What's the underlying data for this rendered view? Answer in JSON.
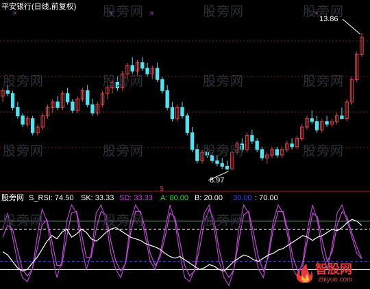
{
  "colors": {
    "background": "#000000",
    "up": "#e0424a",
    "down": "#4fe3f0",
    "white_line": "#ffffff",
    "sk_line": "#b147c9",
    "sd_line": "#c44ad6",
    "upper_band": "#43d94d",
    "lower_band": "#3a4ad8",
    "label_cyan": "#36e0e8",
    "label_green": "#2fd634",
    "label_blue": "#3a4ad8",
    "grid": "#7a1f1f"
  },
  "header": {
    "title": "平安银行(日线,前复权)"
  },
  "price_annotations": {
    "high": "13.86",
    "low": "8.97"
  },
  "watermark": "股旁网",
  "indicator": {
    "name": "股旁网",
    "s_rsi_label": "S_RSI: 74.50",
    "sk_label": "SK: 33.33",
    "sd_label": "SD: 33.33",
    "a_label": "A: 80.00",
    "b_label": "B: 20.00",
    "c_label": "30.00",
    "d_label": ": 70.00"
  },
  "logo": {
    "name": "智股网",
    "url": "zhiyue.com"
  },
  "chart_data": {
    "type": "candlestick",
    "price_panel": {
      "ylim": [
        8.5,
        14.5
      ],
      "high_value": 13.86,
      "low_value": 8.97,
      "candles": [
        [
          11.6,
          11.9,
          11.4,
          11.8
        ],
        [
          11.8,
          12.0,
          11.6,
          11.7
        ],
        [
          11.7,
          11.8,
          11.1,
          11.2
        ],
        [
          11.2,
          11.4,
          10.8,
          10.9
        ],
        [
          10.9,
          11.0,
          10.5,
          10.6
        ],
        [
          10.6,
          10.9,
          10.5,
          10.8
        ],
        [
          10.8,
          10.9,
          10.2,
          10.3
        ],
        [
          10.3,
          10.6,
          10.2,
          10.5
        ],
        [
          10.5,
          11.0,
          10.4,
          10.9
        ],
        [
          10.9,
          11.3,
          10.8,
          11.2
        ],
        [
          11.2,
          11.5,
          11.0,
          11.4
        ],
        [
          11.4,
          11.6,
          11.1,
          11.2
        ],
        [
          11.2,
          11.8,
          11.1,
          11.7
        ],
        [
          11.7,
          11.9,
          11.3,
          11.4
        ],
        [
          11.4,
          11.5,
          11.0,
          11.1
        ],
        [
          11.1,
          11.6,
          11.0,
          11.5
        ],
        [
          11.5,
          11.9,
          11.4,
          11.8
        ],
        [
          11.8,
          12.0,
          11.2,
          11.3
        ],
        [
          11.3,
          11.5,
          10.9,
          11.0
        ],
        [
          11.0,
          11.4,
          10.9,
          11.3
        ],
        [
          11.3,
          11.8,
          11.2,
          11.7
        ],
        [
          11.7,
          12.0,
          11.5,
          11.9
        ],
        [
          11.9,
          12.2,
          11.7,
          12.1
        ],
        [
          12.1,
          12.3,
          11.8,
          11.9
        ],
        [
          11.9,
          12.5,
          11.8,
          12.4
        ],
        [
          12.4,
          12.8,
          12.2,
          12.7
        ],
        [
          12.7,
          13.0,
          12.4,
          12.5
        ],
        [
          12.5,
          12.9,
          12.3,
          12.8
        ],
        [
          12.8,
          13.0,
          12.5,
          12.6
        ],
        [
          12.6,
          12.8,
          12.3,
          12.4
        ],
        [
          12.4,
          12.7,
          12.2,
          12.6
        ],
        [
          12.6,
          12.8,
          12.1,
          12.2
        ],
        [
          12.2,
          12.3,
          11.7,
          11.8
        ],
        [
          11.8,
          12.0,
          11.1,
          11.2
        ],
        [
          11.2,
          11.4,
          10.7,
          10.8
        ],
        [
          10.8,
          11.3,
          10.7,
          11.2
        ],
        [
          11.2,
          11.4,
          10.8,
          10.9
        ],
        [
          10.9,
          11.0,
          10.2,
          10.3
        ],
        [
          10.3,
          10.5,
          9.6,
          9.7
        ],
        [
          9.7,
          9.9,
          9.2,
          9.3
        ],
        [
          9.3,
          9.7,
          9.2,
          9.6
        ],
        [
          9.6,
          9.8,
          9.4,
          9.5
        ],
        [
          9.5,
          9.6,
          9.2,
          9.3
        ],
        [
          9.3,
          9.5,
          9.1,
          9.2
        ],
        [
          9.2,
          9.4,
          9.0,
          9.1
        ],
        [
          9.1,
          9.3,
          8.97,
          9.0
        ],
        [
          9.0,
          9.7,
          8.98,
          9.6
        ],
        [
          9.6,
          10.0,
          9.5,
          9.9
        ],
        [
          9.9,
          10.1,
          9.6,
          9.7
        ],
        [
          9.7,
          10.3,
          9.6,
          10.2
        ],
        [
          10.2,
          10.4,
          9.9,
          10.0
        ],
        [
          10.0,
          10.1,
          9.6,
          9.7
        ],
        [
          9.7,
          9.8,
          9.3,
          9.4
        ],
        [
          9.4,
          9.6,
          9.2,
          9.5
        ],
        [
          9.5,
          9.8,
          9.4,
          9.7
        ],
        [
          9.7,
          9.8,
          9.4,
          9.5
        ],
        [
          9.5,
          9.8,
          9.4,
          9.7
        ],
        [
          9.7,
          10.0,
          9.6,
          9.9
        ],
        [
          9.9,
          10.1,
          9.7,
          9.8
        ],
        [
          9.8,
          10.2,
          9.7,
          10.1
        ],
        [
          10.1,
          10.6,
          10.0,
          10.5
        ],
        [
          10.5,
          10.9,
          10.4,
          10.8
        ],
        [
          10.8,
          11.1,
          10.6,
          10.7
        ],
        [
          10.7,
          10.9,
          10.3,
          10.4
        ],
        [
          10.4,
          10.8,
          10.3,
          10.7
        ],
        [
          10.7,
          10.9,
          10.5,
          10.6
        ],
        [
          10.6,
          10.8,
          10.5,
          10.7
        ],
        [
          10.7,
          11.0,
          10.6,
          10.9
        ],
        [
          10.9,
          11.2,
          10.8,
          10.8
        ],
        [
          10.8,
          11.5,
          10.7,
          11.4
        ],
        [
          11.4,
          12.3,
          11.3,
          12.2
        ],
        [
          12.2,
          13.2,
          12.1,
          13.1
        ],
        [
          13.1,
          13.86,
          13.0,
          13.7
        ]
      ]
    },
    "indicator_panel": {
      "ylim": [
        0,
        100
      ],
      "bands": {
        "A": 80.0,
        "B": 20.0,
        "C": 30.0,
        "D": 70.0
      },
      "s_rsi": [
        42,
        38,
        30,
        22,
        18,
        20,
        28,
        35,
        45,
        55,
        62,
        58,
        66,
        70,
        60,
        64,
        70,
        66,
        58,
        55,
        60,
        66,
        70,
        72,
        68,
        64,
        60,
        58,
        56,
        52,
        50,
        48,
        45,
        40,
        36,
        34,
        36,
        32,
        28,
        24,
        20,
        22,
        26,
        24,
        20,
        18,
        24,
        30,
        34,
        38,
        36,
        32,
        30,
        34,
        38,
        40,
        44,
        46,
        50,
        54,
        58,
        62,
        60,
        56,
        60,
        62,
        66,
        70,
        68,
        72,
        78,
        82,
        80,
        74.5
      ],
      "sk": [
        70,
        90,
        60,
        30,
        10,
        5,
        20,
        60,
        95,
        80,
        40,
        10,
        30,
        80,
        100,
        90,
        50,
        20,
        40,
        90,
        100,
        80,
        40,
        20,
        10,
        30,
        80,
        100,
        90,
        60,
        30,
        20,
        40,
        70,
        100,
        80,
        40,
        10,
        5,
        20,
        60,
        90,
        100,
        70,
        30,
        10,
        0,
        20,
        70,
        100,
        90,
        50,
        20,
        10,
        40,
        80,
        100,
        90,
        60,
        20,
        10,
        30,
        70,
        100,
        80,
        40,
        20,
        50,
        90,
        100,
        80,
        60,
        40,
        33.33
      ],
      "sd": [
        60,
        75,
        70,
        45,
        20,
        12,
        20,
        45,
        75,
        82,
        55,
        25,
        25,
        60,
        90,
        92,
        65,
        35,
        35,
        70,
        92,
        88,
        55,
        30,
        18,
        28,
        65,
        92,
        92,
        70,
        40,
        25,
        35,
        60,
        90,
        85,
        55,
        25,
        12,
        18,
        45,
        78,
        95,
        80,
        45,
        20,
        10,
        20,
        55,
        88,
        92,
        65,
        35,
        18,
        35,
        70,
        92,
        92,
        68,
        35,
        18,
        25,
        58,
        90,
        85,
        55,
        30,
        42,
        75,
        92,
        85,
        65,
        48,
        33.33
      ]
    }
  }
}
